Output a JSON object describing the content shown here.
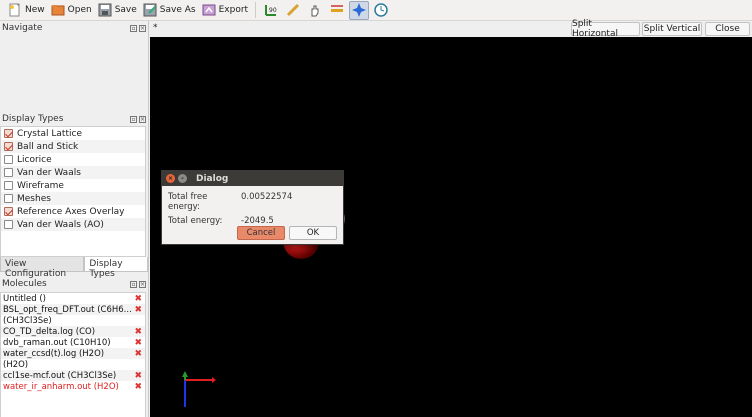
{
  "toolbar": {
    "new_label": "New",
    "open_label": "Open",
    "save_label": "Save",
    "save_as_label": "Save As",
    "export_label": "Export"
  },
  "navigate": {
    "title": "Navigate"
  },
  "display_types": {
    "title": "Display Types",
    "items": [
      {
        "label": "Crystal Lattice",
        "checked": true
      },
      {
        "label": "Ball and Stick",
        "checked": true
      },
      {
        "label": "Licorice",
        "checked": false
      },
      {
        "label": "Van der Waals",
        "checked": false
      },
      {
        "label": "Wireframe",
        "checked": false
      },
      {
        "label": "Meshes",
        "checked": false
      },
      {
        "label": "Reference Axes Overlay",
        "checked": true
      },
      {
        "label": "Van der Waals (AO)",
        "checked": false
      }
    ]
  },
  "tabs": {
    "view_config": "View Configuration",
    "display_types": "Display Types"
  },
  "molecules": {
    "title": "Molecules",
    "items": [
      "Untitled ()",
      "BSL_opt_freq_DFT.out (C6H6...",
      " (CH3Cl3Se)",
      "CO_TD_delta.log (CO)",
      "dvb_raman.out (C10H10)",
      "water_ccsd(t).log (H2O)",
      " (H2O)",
      "ccl1se-mcf.out (CH3Cl3Se)",
      "water_ir_anharm.out (H2O)"
    ]
  },
  "viewport": {
    "tab_marker": "*",
    "split_horizontal": "Split Horizontal",
    "split_vertical": "Split Vertical",
    "close": "Close"
  },
  "dialog": {
    "title": "Dialog",
    "free_energy_label": "Total free energy:",
    "free_energy_value": "0.00522574",
    "energy_label": "Total energy:",
    "energy_value": "-2049.5",
    "cancel": "Cancel",
    "ok": "OK"
  },
  "colors": {
    "oxygen": "#d11a1a",
    "hydrogen": "#e8e8e8",
    "selected_molecule": "#e02020"
  }
}
